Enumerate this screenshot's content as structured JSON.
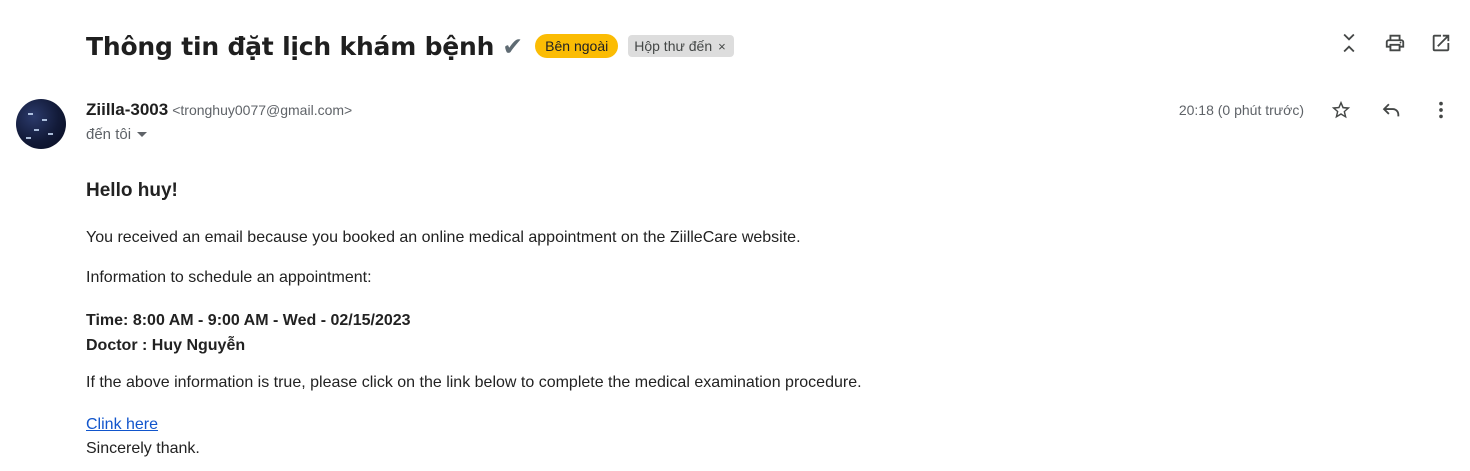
{
  "header": {
    "subject": "Thông tin đặt lịch khám bệnh",
    "subject_check": "✔",
    "labels": {
      "external": "Bên ngoài",
      "inbox": "Hộp thư đến",
      "inbox_remove": "×"
    },
    "actions": [
      "collapse-icon",
      "print-icon",
      "open-new-window-icon"
    ]
  },
  "sender": {
    "name": "Ziilla-3003",
    "email": "<tronghuy0077@gmail.com>",
    "recipient": "đến tôi",
    "timestamp": "20:18 (0 phút trước)"
  },
  "message": {
    "greeting": "Hello huy!",
    "intro": "You received an email because you booked an online medical appointment on the ZiilleCare website.",
    "schedule_heading": "Information to schedule an appointment:",
    "time": "Time: 8:00 AM - 9:00 AM - Wed - 02/15/2023",
    "doctor": "Doctor : Huy Nguyễn",
    "instruction": "If the above information is true, please click on the link below to complete the medical examination procedure.",
    "link_text": "Clink here",
    "closing": "Sincerely thank."
  },
  "colors": {
    "external_label": "#fbbc04",
    "inbox_label": "#dddddd",
    "link": "#1155cc"
  }
}
